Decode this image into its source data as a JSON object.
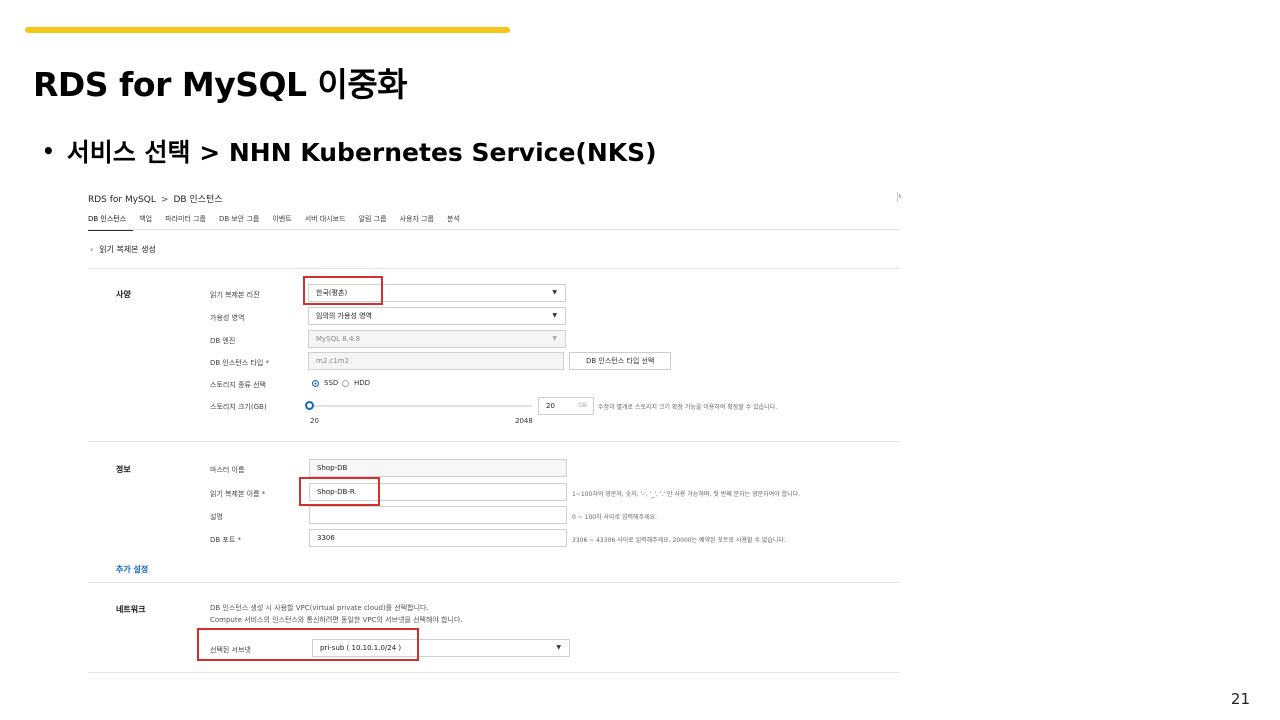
{
  "slide": {
    "title": "RDS for MySQL 이중화",
    "bullet_mark": "•",
    "bullet": "서비스 선택 > NHN Kubernetes Service(NKS)",
    "page_number": "21",
    "accent_color": "#f5c518"
  },
  "console": {
    "breadcrumb": [
      "RDS for MySQL",
      "DB 인스턴스"
    ],
    "breadcrumb_sep": ">",
    "corner_glyph": "ι",
    "tabs": [
      "DB 인스턴스",
      "백업",
      "파라미터 그룹",
      "DB 보안 그룹",
      "이벤트",
      "서버 대시보드",
      "알림 그룹",
      "사용자 그룹",
      "분석"
    ],
    "active_tab": "DB 인스턴스",
    "back_label": "읽기 복제본 생성",
    "back_icon": "chevron-left-icon",
    "spec": {
      "section": "사양",
      "region_label": "읽기 복제본 리전",
      "region_value": "한국(평촌)",
      "az_label": "가용성 영역",
      "az_value": "임의의 가용성 영역",
      "engine_label": "DB 엔진",
      "engine_value": "MySQL 8.4.8",
      "instance_type_label": "DB 인스턴스 타입 *",
      "instance_type_placeholder": "m2.c1m2",
      "instance_type_button": "DB 인스턴스 타입 선택",
      "storage_type_label": "스토리지 종류 선택",
      "storage_types": [
        "SSD",
        "HDD"
      ],
      "storage_type_selected": "SSD",
      "storage_size_label": "스토리지 크기(GB)",
      "storage_min": "20",
      "storage_max": "2048",
      "storage_value": "20",
      "storage_unit": "GB",
      "storage_fraction": 0.0,
      "storage_hint": "수정과 별개로 스토리지 크기 확장 기능을 이용하여 확장할 수 있습니다."
    },
    "info": {
      "section": "정보",
      "master_label": "마스터 이름",
      "master_value": "Shop-DB",
      "replica_label": "읽기 복제본 이름 *",
      "replica_value": "Shop-DB-R",
      "replica_hint": "1~100자의 영문자, 숫자, '-', '_', '.' 만 사용 가능하며, 첫 번째 문자는 영문자여야 합니다.",
      "desc_label": "설명",
      "desc_value": "",
      "desc_hint": "0 ~ 100자 사이로 입력해주세요.",
      "port_label": "DB 포트 *",
      "port_value": "3306",
      "port_hint": "3306 ~ 43306 사이로 입력해주세요. 20000는 예약된 포트로 사용할 수 없습니다."
    },
    "extra_settings": "추가 설정",
    "network": {
      "section": "네트워크",
      "desc_line1": "DB 인스턴스 생성 시 사용할 VPC(virtual private cloud)를 선택합니다.",
      "desc_line2": "Compute 서비스의 인스턴스와 통신하려면 동일한 VPC의 서브넷을 선택해야 합니다.",
      "subnet_label": "선택된 서브넷",
      "subnet_value": "pri-sub ( 10.10.1.0/24 )"
    },
    "highlight_color": "#d32f2f",
    "primary_color": "#1565c0"
  }
}
